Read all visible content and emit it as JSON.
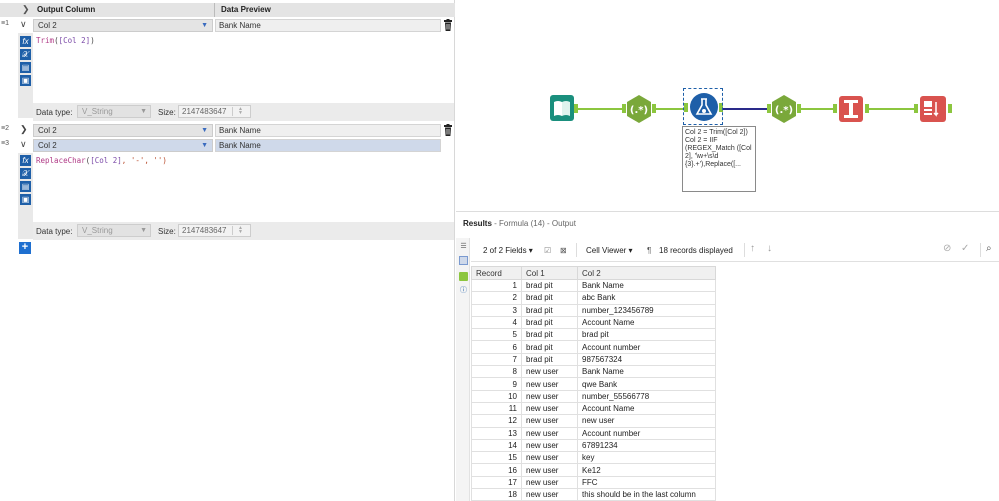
{
  "left_panel": {
    "header": {
      "output_column": "Output Column",
      "data_preview": "Data Preview"
    },
    "formulas": [
      {
        "index": "1",
        "column": "Col 2",
        "preview": "Bank Name",
        "expression": {
          "fn": "Trim",
          "open": "(",
          "field": "[Col 2]",
          "close": ")"
        },
        "data_type_label": "Data type:",
        "data_type": "V_String",
        "size_label": "Size:",
        "size": "2147483647"
      },
      {
        "index": "2",
        "column": "Col 2",
        "preview": "Bank Name"
      },
      {
        "index": "3",
        "column": "Col 2",
        "preview": "Bank Name",
        "expression": {
          "fn": "ReplaceChar",
          "open": "(",
          "field": "[Col 2]",
          "rest": ", '-', '')"
        },
        "data_type_label": "Data type:",
        "data_type": "V_String",
        "size_label": "Size:",
        "size": "2147483647"
      }
    ],
    "add_label": "+"
  },
  "workflow": {
    "tooltip": "Col 2 = Trim([Col 2])\nCol 2 = IIF (REGEX_Match ([Col 2], '\\w+\\s\\d {3}.+'),Replace([..."
  },
  "results": {
    "title_bold": "Results",
    "title_rest": " - Formula (14) - Output",
    "fields_label": "2 of 2 Fields",
    "viewer_label": "Cell Viewer",
    "records_label": "18 records displayed",
    "columns": [
      "Record",
      "Col 1",
      "Col 2"
    ],
    "rows": [
      [
        "1",
        "brad pit",
        "Bank Name"
      ],
      [
        "2",
        "brad pit",
        "abc Bank"
      ],
      [
        "3",
        "brad pit",
        "number_123456789"
      ],
      [
        "4",
        "brad pit",
        "Account Name"
      ],
      [
        "5",
        "brad pit",
        "brad pit"
      ],
      [
        "6",
        "brad pit",
        "Account number"
      ],
      [
        "7",
        "brad pit",
        "987567324"
      ],
      [
        "8",
        "new user",
        "Bank Name"
      ],
      [
        "9",
        "new user",
        "qwe Bank"
      ],
      [
        "10",
        "new user",
        "number_55566778"
      ],
      [
        "11",
        "new user",
        "Account Name"
      ],
      [
        "12",
        "new user",
        "new user"
      ],
      [
        "13",
        "new user",
        "Account number"
      ],
      [
        "14",
        "new user",
        "67891234"
      ],
      [
        "15",
        "new user",
        "key"
      ],
      [
        "16",
        "new user",
        "Ke12"
      ],
      [
        "17",
        "new user",
        "FFC"
      ],
      [
        "18",
        "new user",
        "this should be in the last column"
      ]
    ]
  },
  "colors": {
    "node_teal": "#1a8f7d",
    "node_green": "#7aa83a",
    "node_blue": "#1e5fa8",
    "node_red": "#d9534f",
    "connector_green": "#8cc63f",
    "connector_navy": "#2a2a8a"
  }
}
